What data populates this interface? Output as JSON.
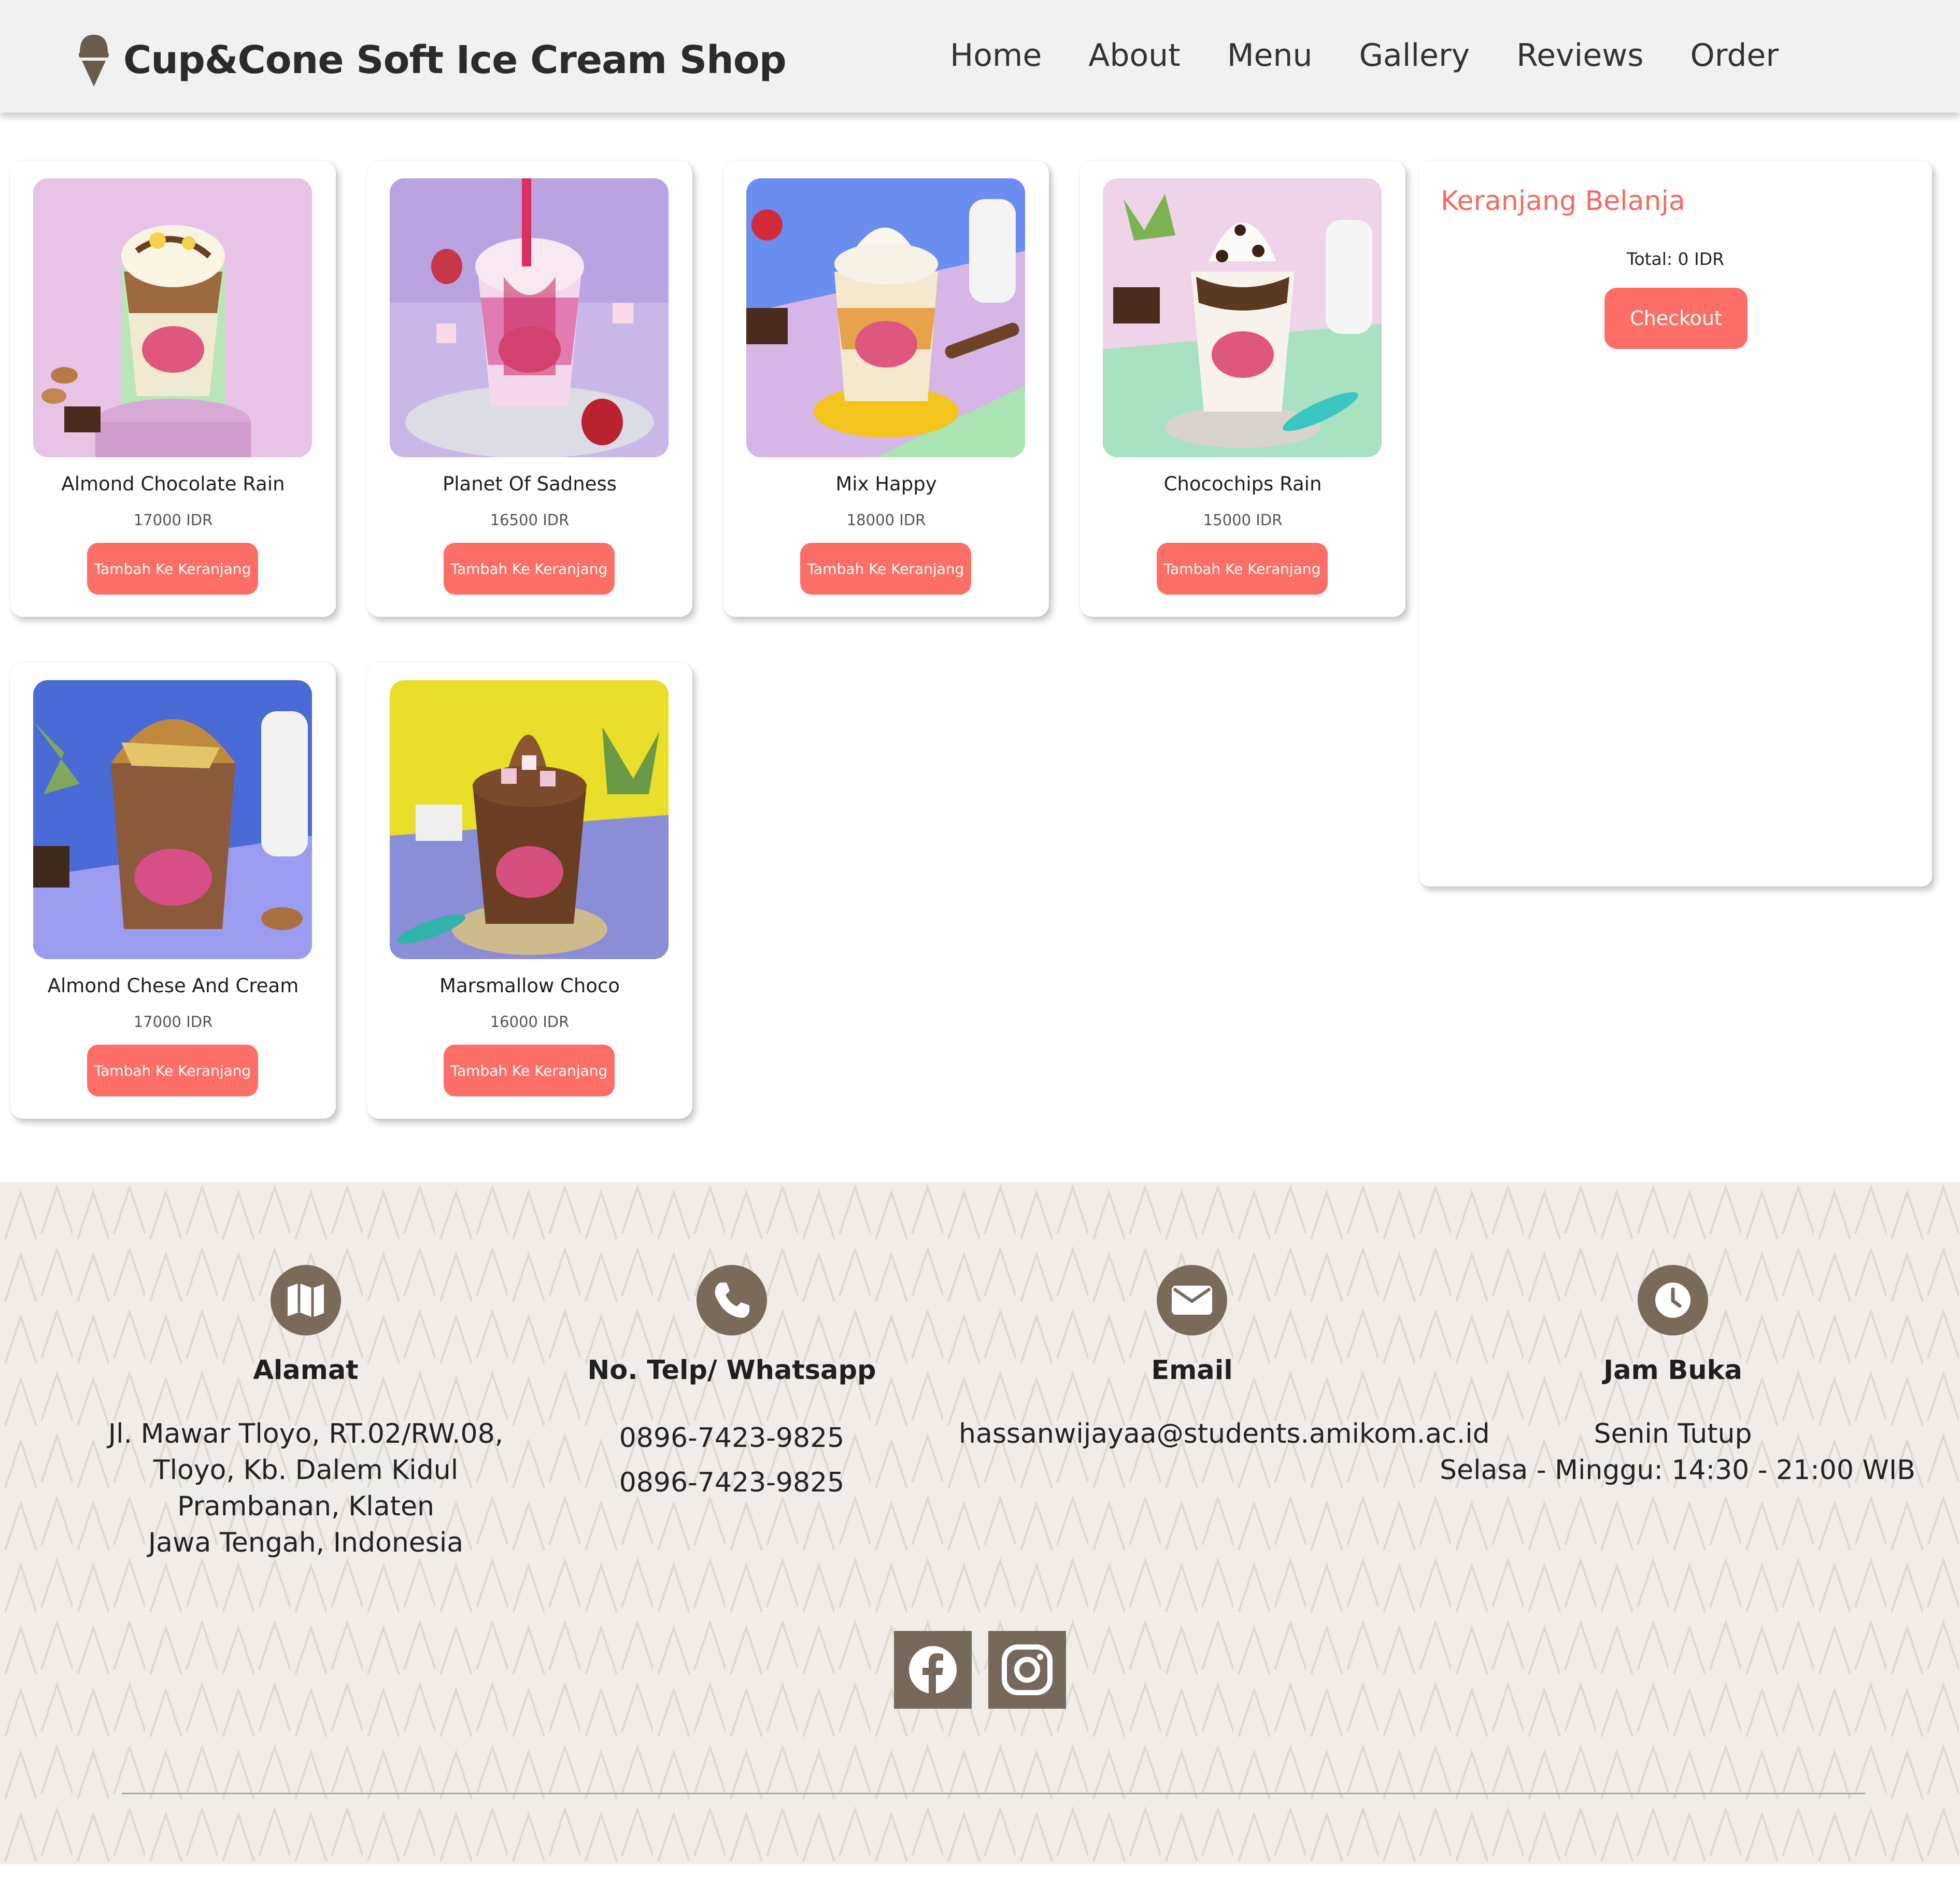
{
  "header": {
    "brand": "Cup&Cone Soft Ice Cream Shop",
    "nav": [
      "Home",
      "About",
      "Menu",
      "Gallery",
      "Reviews",
      "Order"
    ]
  },
  "products": [
    {
      "name": "Almond Chocolate Rain",
      "price": "17000 IDR",
      "button": "Tambah Ke Keranjang"
    },
    {
      "name": "Planet Of Sadness",
      "price": "16500 IDR",
      "button": "Tambah Ke Keranjang"
    },
    {
      "name": "Mix Happy",
      "price": "18000 IDR",
      "button": "Tambah Ke Keranjang"
    },
    {
      "name": "Chocochips Rain",
      "price": "15000 IDR",
      "button": "Tambah Ke Keranjang"
    },
    {
      "name": "Almond Chese And Cream",
      "price": "17000 IDR",
      "button": "Tambah Ke Keranjang"
    },
    {
      "name": "Marsmallow Choco",
      "price": "16000 IDR",
      "button": "Tambah Ke Keranjang"
    }
  ],
  "cart": {
    "title": "Keranjang Belanja",
    "total": "Total: 0 IDR",
    "checkout": "Checkout"
  },
  "footer": {
    "address": {
      "title": "Alamat",
      "lines": [
        "Jl. Mawar Tloyo, RT.02/RW.08,",
        "Tloyo, Kb. Dalem Kidul",
        "Prambanan, Klaten",
        "Jawa Tengah, Indonesia"
      ]
    },
    "phone": {
      "title": "No. Telp/ Whatsapp",
      "lines": [
        "0896-7423-9825",
        "0896-7423-9825"
      ]
    },
    "email": {
      "title": "Email",
      "lines": [
        "hassanwijayaa@students.amikom.ac.id"
      ]
    },
    "hours": {
      "title": "Jam Buka",
      "lines": [
        "Senin Tutup",
        "Selasa - Minggu: 14:30 - 21:00 WIB"
      ]
    },
    "social": [
      "facebook-icon",
      "instagram-icon"
    ]
  },
  "colors": {
    "accent": "#fd6f66",
    "cart_title": "#f36b60",
    "navbar_bg": "#f1f1f2",
    "footer_bg": "#f1ece7",
    "icon_brown": "#7a6a5a"
  }
}
